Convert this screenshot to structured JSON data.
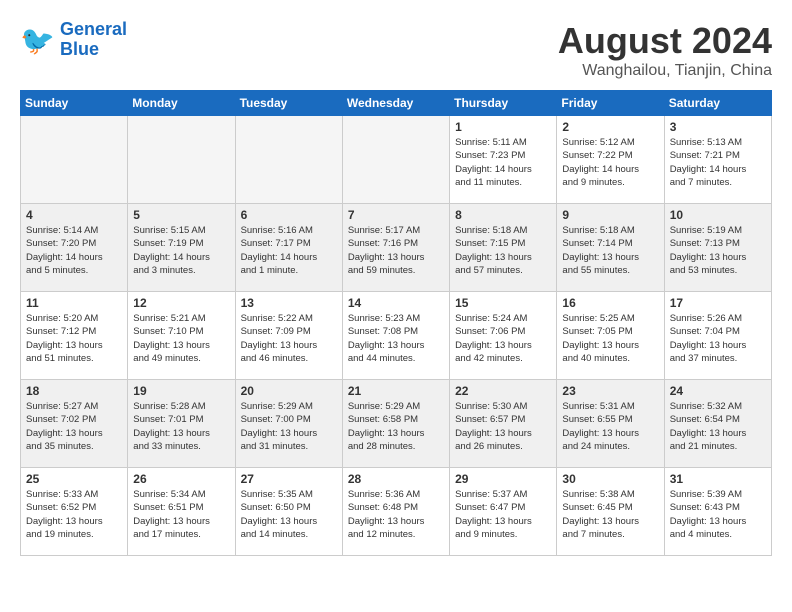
{
  "header": {
    "logo_line1": "General",
    "logo_line2": "Blue",
    "month": "August 2024",
    "location": "Wanghailou, Tianjin, China"
  },
  "days_of_week": [
    "Sunday",
    "Monday",
    "Tuesday",
    "Wednesday",
    "Thursday",
    "Friday",
    "Saturday"
  ],
  "weeks": [
    [
      {
        "day": "",
        "empty": true
      },
      {
        "day": "",
        "empty": true
      },
      {
        "day": "",
        "empty": true
      },
      {
        "day": "",
        "empty": true
      },
      {
        "day": "1",
        "info": "Sunrise: 5:11 AM\nSunset: 7:23 PM\nDaylight: 14 hours\nand 11 minutes."
      },
      {
        "day": "2",
        "info": "Sunrise: 5:12 AM\nSunset: 7:22 PM\nDaylight: 14 hours\nand 9 minutes."
      },
      {
        "day": "3",
        "info": "Sunrise: 5:13 AM\nSunset: 7:21 PM\nDaylight: 14 hours\nand 7 minutes."
      }
    ],
    [
      {
        "day": "4",
        "info": "Sunrise: 5:14 AM\nSunset: 7:20 PM\nDaylight: 14 hours\nand 5 minutes.",
        "shaded": true
      },
      {
        "day": "5",
        "info": "Sunrise: 5:15 AM\nSunset: 7:19 PM\nDaylight: 14 hours\nand 3 minutes.",
        "shaded": true
      },
      {
        "day": "6",
        "info": "Sunrise: 5:16 AM\nSunset: 7:17 PM\nDaylight: 14 hours\nand 1 minute.",
        "shaded": true
      },
      {
        "day": "7",
        "info": "Sunrise: 5:17 AM\nSunset: 7:16 PM\nDaylight: 13 hours\nand 59 minutes.",
        "shaded": true
      },
      {
        "day": "8",
        "info": "Sunrise: 5:18 AM\nSunset: 7:15 PM\nDaylight: 13 hours\nand 57 minutes.",
        "shaded": true
      },
      {
        "day": "9",
        "info": "Sunrise: 5:18 AM\nSunset: 7:14 PM\nDaylight: 13 hours\nand 55 minutes.",
        "shaded": true
      },
      {
        "day": "10",
        "info": "Sunrise: 5:19 AM\nSunset: 7:13 PM\nDaylight: 13 hours\nand 53 minutes.",
        "shaded": true
      }
    ],
    [
      {
        "day": "11",
        "info": "Sunrise: 5:20 AM\nSunset: 7:12 PM\nDaylight: 13 hours\nand 51 minutes."
      },
      {
        "day": "12",
        "info": "Sunrise: 5:21 AM\nSunset: 7:10 PM\nDaylight: 13 hours\nand 49 minutes."
      },
      {
        "day": "13",
        "info": "Sunrise: 5:22 AM\nSunset: 7:09 PM\nDaylight: 13 hours\nand 46 minutes."
      },
      {
        "day": "14",
        "info": "Sunrise: 5:23 AM\nSunset: 7:08 PM\nDaylight: 13 hours\nand 44 minutes."
      },
      {
        "day": "15",
        "info": "Sunrise: 5:24 AM\nSunset: 7:06 PM\nDaylight: 13 hours\nand 42 minutes."
      },
      {
        "day": "16",
        "info": "Sunrise: 5:25 AM\nSunset: 7:05 PM\nDaylight: 13 hours\nand 40 minutes."
      },
      {
        "day": "17",
        "info": "Sunrise: 5:26 AM\nSunset: 7:04 PM\nDaylight: 13 hours\nand 37 minutes."
      }
    ],
    [
      {
        "day": "18",
        "info": "Sunrise: 5:27 AM\nSunset: 7:02 PM\nDaylight: 13 hours\nand 35 minutes.",
        "shaded": true
      },
      {
        "day": "19",
        "info": "Sunrise: 5:28 AM\nSunset: 7:01 PM\nDaylight: 13 hours\nand 33 minutes.",
        "shaded": true
      },
      {
        "day": "20",
        "info": "Sunrise: 5:29 AM\nSunset: 7:00 PM\nDaylight: 13 hours\nand 31 minutes.",
        "shaded": true
      },
      {
        "day": "21",
        "info": "Sunrise: 5:29 AM\nSunset: 6:58 PM\nDaylight: 13 hours\nand 28 minutes.",
        "shaded": true
      },
      {
        "day": "22",
        "info": "Sunrise: 5:30 AM\nSunset: 6:57 PM\nDaylight: 13 hours\nand 26 minutes.",
        "shaded": true
      },
      {
        "day": "23",
        "info": "Sunrise: 5:31 AM\nSunset: 6:55 PM\nDaylight: 13 hours\nand 24 minutes.",
        "shaded": true
      },
      {
        "day": "24",
        "info": "Sunrise: 5:32 AM\nSunset: 6:54 PM\nDaylight: 13 hours\nand 21 minutes.",
        "shaded": true
      }
    ],
    [
      {
        "day": "25",
        "info": "Sunrise: 5:33 AM\nSunset: 6:52 PM\nDaylight: 13 hours\nand 19 minutes."
      },
      {
        "day": "26",
        "info": "Sunrise: 5:34 AM\nSunset: 6:51 PM\nDaylight: 13 hours\nand 17 minutes."
      },
      {
        "day": "27",
        "info": "Sunrise: 5:35 AM\nSunset: 6:50 PM\nDaylight: 13 hours\nand 14 minutes."
      },
      {
        "day": "28",
        "info": "Sunrise: 5:36 AM\nSunset: 6:48 PM\nDaylight: 13 hours\nand 12 minutes."
      },
      {
        "day": "29",
        "info": "Sunrise: 5:37 AM\nSunset: 6:47 PM\nDaylight: 13 hours\nand 9 minutes."
      },
      {
        "day": "30",
        "info": "Sunrise: 5:38 AM\nSunset: 6:45 PM\nDaylight: 13 hours\nand 7 minutes."
      },
      {
        "day": "31",
        "info": "Sunrise: 5:39 AM\nSunset: 6:43 PM\nDaylight: 13 hours\nand 4 minutes."
      }
    ]
  ]
}
